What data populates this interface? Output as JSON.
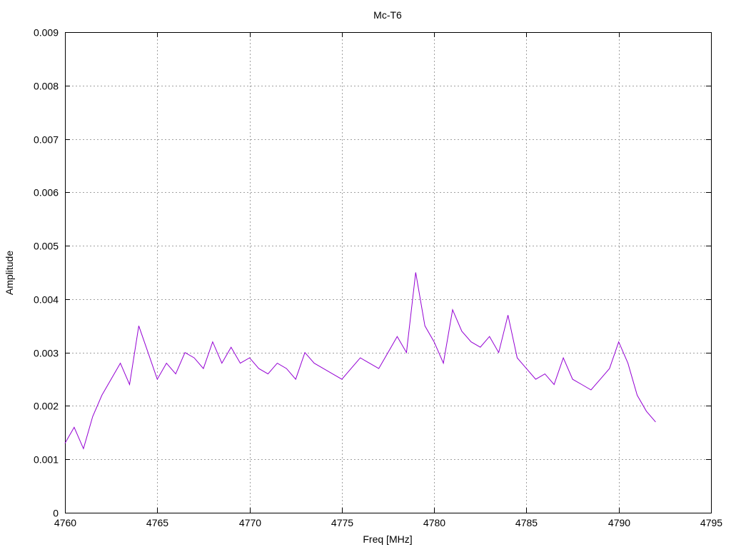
{
  "chart_data": {
    "type": "line",
    "title": "Mc-T6",
    "xlabel": "Freq [MHz]",
    "ylabel": "Amplitude",
    "xlim": [
      4760,
      4795
    ],
    "ylim": [
      0,
      0.009
    ],
    "x_ticks": [
      4760,
      4765,
      4770,
      4775,
      4780,
      4785,
      4790,
      4795
    ],
    "y_ticks": [
      0,
      0.001,
      0.002,
      0.003,
      0.004,
      0.005,
      0.006,
      0.007,
      0.008,
      0.009
    ],
    "x_tick_labels": [
      "4760",
      "4765",
      "4770",
      "4775",
      "4780",
      "4785",
      "4790",
      "4795"
    ],
    "y_tick_labels": [
      "0",
      "0.001",
      "0.002",
      "0.003",
      "0.004",
      "0.005",
      "0.006",
      "0.007",
      "0.008",
      "0.009"
    ],
    "grid": true,
    "series_color": "#9400d3",
    "series": [
      {
        "name": "",
        "x": [
          4760.0,
          4760.5,
          4761.0,
          4761.5,
          4762.0,
          4762.5,
          4763.0,
          4763.5,
          4764.0,
          4764.5,
          4765.0,
          4765.5,
          4766.0,
          4766.5,
          4767.0,
          4767.5,
          4768.0,
          4768.5,
          4769.0,
          4769.5,
          4770.0,
          4770.5,
          4771.0,
          4771.5,
          4772.0,
          4772.5,
          4773.0,
          4773.5,
          4774.0,
          4774.5,
          4775.0,
          4775.5,
          4776.0,
          4776.5,
          4777.0,
          4777.5,
          4778.0,
          4778.5,
          4779.0,
          4779.5,
          4780.0,
          4780.5,
          4781.0,
          4781.5,
          4782.0,
          4782.5,
          4783.0,
          4783.5,
          4784.0,
          4784.5,
          4785.0,
          4785.5,
          4786.0,
          4786.5,
          4787.0,
          4787.5,
          4788.0,
          4788.5,
          4789.0,
          4789.5,
          4790.0,
          4790.5,
          4791.0,
          4791.5,
          4792.0
        ],
        "y": [
          0.0013,
          0.0016,
          0.0012,
          0.0018,
          0.0022,
          0.0025,
          0.0028,
          0.0024,
          0.0035,
          0.003,
          0.0025,
          0.0028,
          0.0026,
          0.003,
          0.0029,
          0.0027,
          0.0032,
          0.0028,
          0.0031,
          0.0028,
          0.0029,
          0.0027,
          0.0026,
          0.0028,
          0.0027,
          0.0025,
          0.003,
          0.0028,
          0.0027,
          0.0026,
          0.0025,
          0.0027,
          0.0029,
          0.0028,
          0.0027,
          0.003,
          0.0033,
          0.003,
          0.0045,
          0.0035,
          0.0032,
          0.0028,
          0.0038,
          0.0034,
          0.0032,
          0.0031,
          0.0033,
          0.003,
          0.0037,
          0.0029,
          0.0027,
          0.0025,
          0.0026,
          0.0024,
          0.0029,
          0.0025,
          0.0024,
          0.0023,
          0.0025,
          0.0027,
          0.0032,
          0.0028,
          0.0022,
          0.0019,
          0.0017
        ]
      }
    ]
  }
}
